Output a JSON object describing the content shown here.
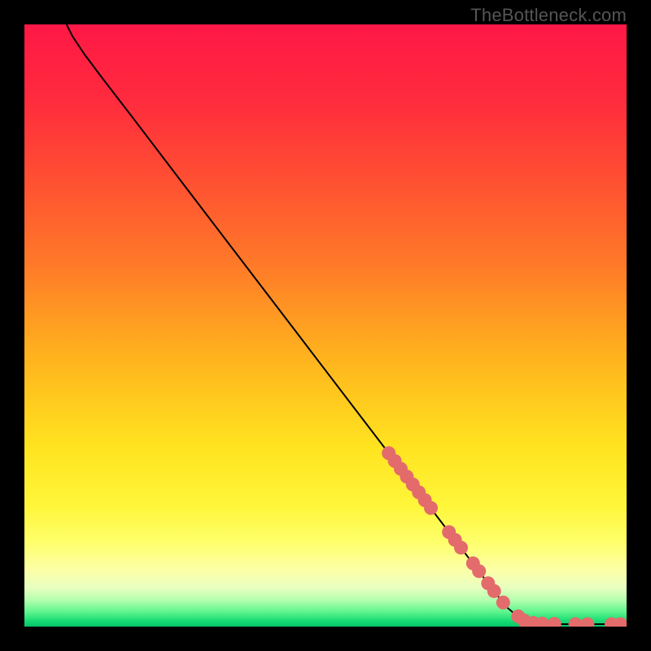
{
  "attribution": "TheBottleneck.com",
  "colors": {
    "frame": "#000000",
    "curve": "#000000",
    "marker_fill": "#e36b6b",
    "marker_stroke": "#c94f4f",
    "gradient_stops": [
      {
        "offset": 0.0,
        "color": "#ff1846"
      },
      {
        "offset": 0.12,
        "color": "#ff2a3e"
      },
      {
        "offset": 0.25,
        "color": "#ff4d33"
      },
      {
        "offset": 0.4,
        "color": "#ff7a28"
      },
      {
        "offset": 0.55,
        "color": "#ffb21e"
      },
      {
        "offset": 0.7,
        "color": "#ffe31f"
      },
      {
        "offset": 0.8,
        "color": "#fff63a"
      },
      {
        "offset": 0.86,
        "color": "#feff6b"
      },
      {
        "offset": 0.905,
        "color": "#fcffa6"
      },
      {
        "offset": 0.935,
        "color": "#e9ffc0"
      },
      {
        "offset": 0.955,
        "color": "#b7ffb0"
      },
      {
        "offset": 0.975,
        "color": "#62f58e"
      },
      {
        "offset": 0.99,
        "color": "#18dd74"
      },
      {
        "offset": 1.0,
        "color": "#05c566"
      }
    ]
  },
  "chart_data": {
    "type": "line",
    "xlim": [
      0,
      100
    ],
    "ylim": [
      0,
      100
    ],
    "title": "",
    "xlabel": "",
    "ylabel": "",
    "curve": [
      {
        "x": 7.0,
        "y": 100.0
      },
      {
        "x": 8.0,
        "y": 98.0
      },
      {
        "x": 10.0,
        "y": 95.0
      },
      {
        "x": 13.0,
        "y": 91.0
      },
      {
        "x": 18.0,
        "y": 84.5
      },
      {
        "x": 25.0,
        "y": 75.3
      },
      {
        "x": 35.0,
        "y": 62.2
      },
      {
        "x": 45.0,
        "y": 49.1
      },
      {
        "x": 55.0,
        "y": 36.0
      },
      {
        "x": 65.0,
        "y": 22.9
      },
      {
        "x": 75.0,
        "y": 9.8
      },
      {
        "x": 80.0,
        "y": 3.3
      },
      {
        "x": 82.5,
        "y": 1.2
      },
      {
        "x": 84.0,
        "y": 0.6
      },
      {
        "x": 86.0,
        "y": 0.4
      },
      {
        "x": 90.0,
        "y": 0.4
      },
      {
        "x": 95.0,
        "y": 0.4
      },
      {
        "x": 100.0,
        "y": 0.4
      }
    ],
    "markers": [
      {
        "x": 60.5,
        "y": 28.8
      },
      {
        "x": 61.5,
        "y": 27.5
      },
      {
        "x": 62.5,
        "y": 26.2
      },
      {
        "x": 63.5,
        "y": 24.9
      },
      {
        "x": 64.5,
        "y": 23.6
      },
      {
        "x": 65.5,
        "y": 22.3
      },
      {
        "x": 66.5,
        "y": 21.0
      },
      {
        "x": 67.5,
        "y": 19.7
      },
      {
        "x": 70.5,
        "y": 15.7
      },
      {
        "x": 71.5,
        "y": 14.4
      },
      {
        "x": 72.5,
        "y": 13.1
      },
      {
        "x": 74.5,
        "y": 10.5
      },
      {
        "x": 75.5,
        "y": 9.2
      },
      {
        "x": 77.0,
        "y": 7.2
      },
      {
        "x": 78.0,
        "y": 5.9
      },
      {
        "x": 79.5,
        "y": 4.0
      },
      {
        "x": 82.0,
        "y": 1.7
      },
      {
        "x": 83.0,
        "y": 1.0
      },
      {
        "x": 84.5,
        "y": 0.6
      },
      {
        "x": 86.0,
        "y": 0.5
      },
      {
        "x": 88.0,
        "y": 0.45
      },
      {
        "x": 91.5,
        "y": 0.4
      },
      {
        "x": 93.5,
        "y": 0.4
      },
      {
        "x": 97.5,
        "y": 0.4
      },
      {
        "x": 99.0,
        "y": 0.4
      }
    ]
  }
}
